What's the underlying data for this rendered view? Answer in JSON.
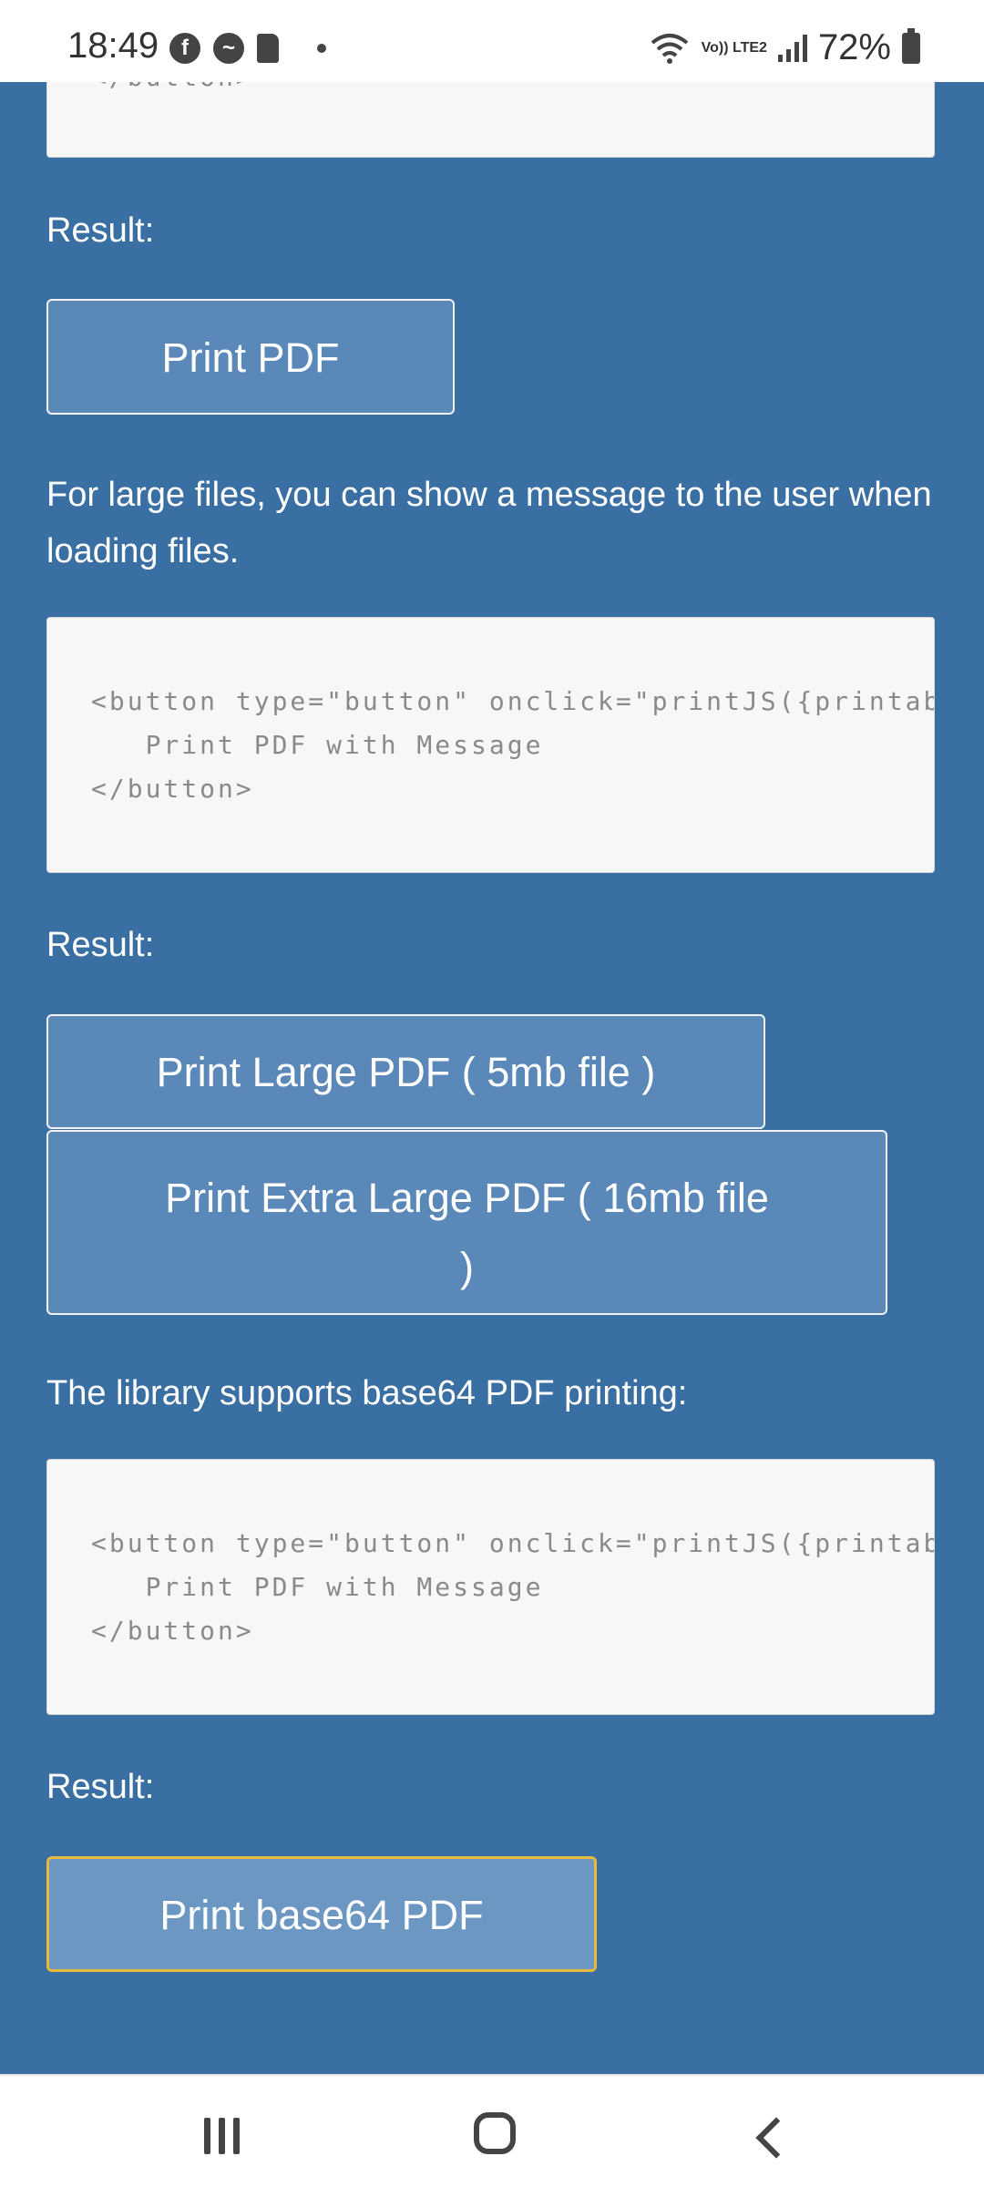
{
  "status_bar": {
    "time": "18:49",
    "notification_icons": [
      "facebook-icon",
      "messenger-icon",
      "sd-card-icon",
      "dot-icon"
    ],
    "battery_percent": "72%",
    "network_label": "Vo)) LTE2"
  },
  "content": {
    "top_code_tail": "</button>",
    "result_label_1": "Result:",
    "button_print_pdf": "Print PDF",
    "large_files_paragraph": "For large files, you can show a message to the user when loading files.",
    "code_block_2": {
      "line1": "<button type=\"button\" onclick=\"printJS({printab",
      "line2": "   Print PDF with Message",
      "line3": "</button>"
    },
    "result_label_2": "Result:",
    "button_print_large": "Print Large PDF ( 5mb file )",
    "button_print_extra_large_line1": "Print Extra Large PDF ( 16mb file",
    "button_print_extra_large_line2": ")",
    "base64_paragraph": "The library supports base64 PDF printing:",
    "code_block_3": {
      "line1": "<button type=\"button\" onclick=\"printJS({printab",
      "line2": "   Print PDF with Message",
      "line3": "</button>"
    },
    "result_label_3": "Result:",
    "button_print_base64": "Print base64 PDF"
  },
  "nav_bar": {
    "icons": [
      "recent-apps-icon",
      "home-icon",
      "back-icon"
    ]
  }
}
